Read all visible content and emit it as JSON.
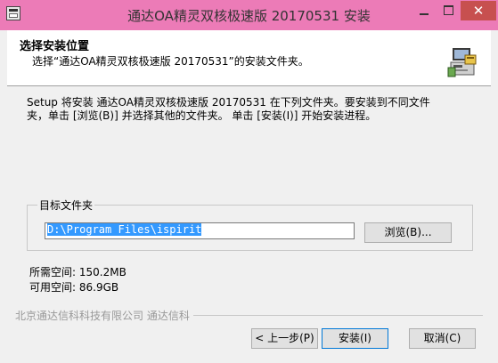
{
  "window": {
    "title": "通达OA精灵双核极速版 20170531 安装",
    "close_symbol": "✕"
  },
  "header": {
    "title": "选择安装位置",
    "subtitle": "选择“通达OA精灵双核极速版 20170531”的安装文件夹。"
  },
  "body": {
    "description_line1": "Setup 将安装 通达OA精灵双核极速版 20170531 在下列文件夹。要安装到不同文件",
    "description_line2": "夹，单击 [浏览(B)] 并选择其他的文件夹。 单击 [安装(I)] 开始安装进程。",
    "group_label": "目标文件夹",
    "path_value": "D:\\Program Files\\ispirit",
    "browse_label": "浏览(B)...",
    "space_required_label": "所需空间:",
    "space_required_value": "150.2MB",
    "space_available_label": "可用空间:",
    "space_available_value": "86.9GB"
  },
  "footer": {
    "company": "北京通达信科科技有限公司 通达信科",
    "back_label": "< 上一步(P)",
    "install_label": "安装(I)",
    "cancel_label": "取消(C)"
  },
  "colors": {
    "titlebar": "#ec7bb7",
    "close_button": "#c7504f"
  }
}
